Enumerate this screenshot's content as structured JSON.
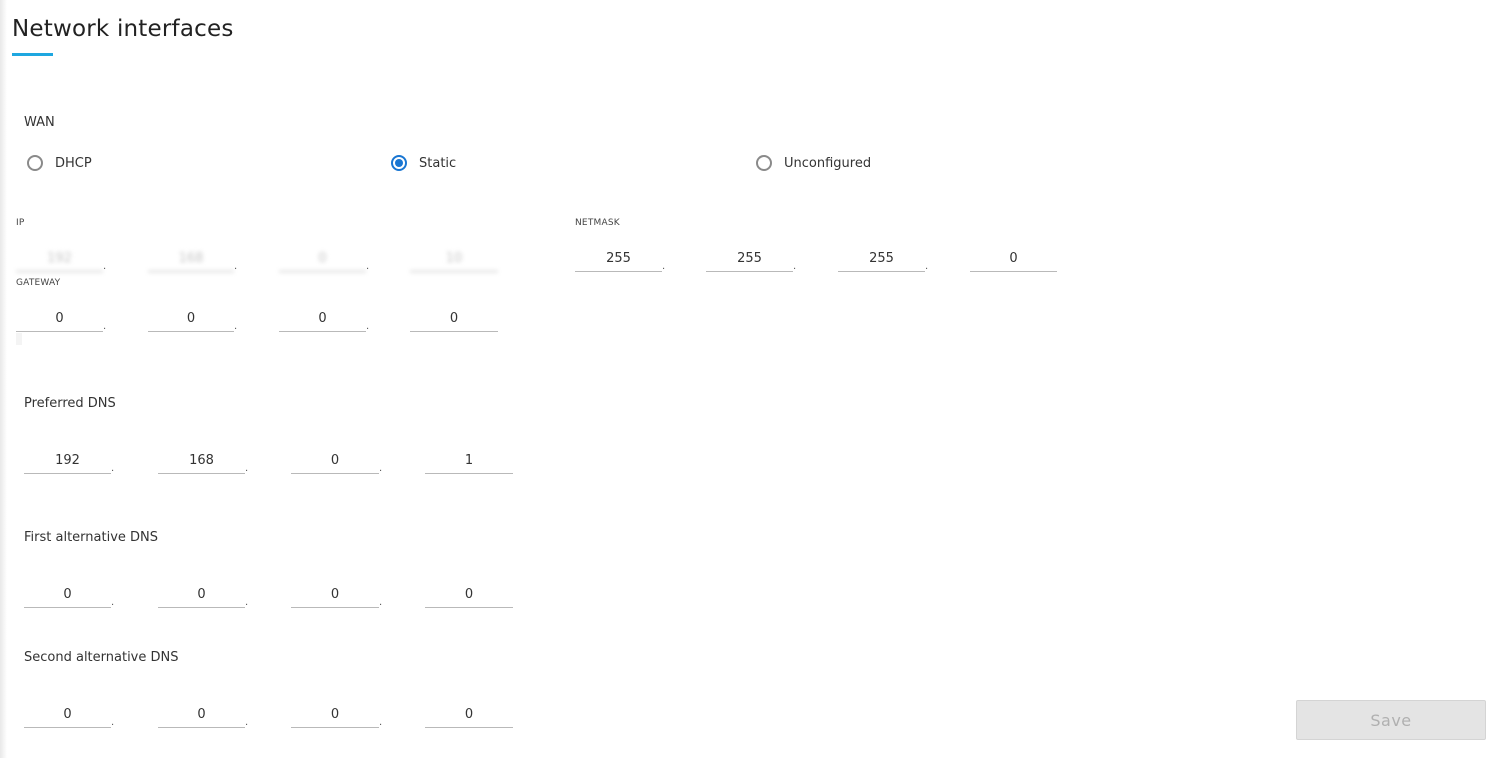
{
  "page": {
    "title": "Network interfaces"
  },
  "wan": {
    "label": "WAN",
    "modes": [
      "DHCP",
      "Static",
      "Unconfigured"
    ],
    "selected": "Static"
  },
  "ip": {
    "label": "IP",
    "octets": [
      "192",
      "168",
      "0",
      "10"
    ]
  },
  "netmask": {
    "label": "NETMASK",
    "octets": [
      "255",
      "255",
      "255",
      "0"
    ]
  },
  "gateway": {
    "label": "GATEWAY",
    "octets": [
      "0",
      "0",
      "0",
      "0"
    ]
  },
  "preferred_dns": {
    "label": "Preferred DNS",
    "octets": [
      "192",
      "168",
      "0",
      "1"
    ]
  },
  "first_alt_dns": {
    "label": "First alternative DNS",
    "octets": [
      "0",
      "0",
      "0",
      "0"
    ]
  },
  "second_alt_dns": {
    "label": "Second alternative DNS",
    "octets": [
      "0",
      "0",
      "0",
      "0"
    ]
  },
  "save_label": "Save",
  "colors": {
    "accent": "#1ea7e0",
    "radio_selected": "#1976d2",
    "button_disabled_bg": "#e4e4e4"
  }
}
